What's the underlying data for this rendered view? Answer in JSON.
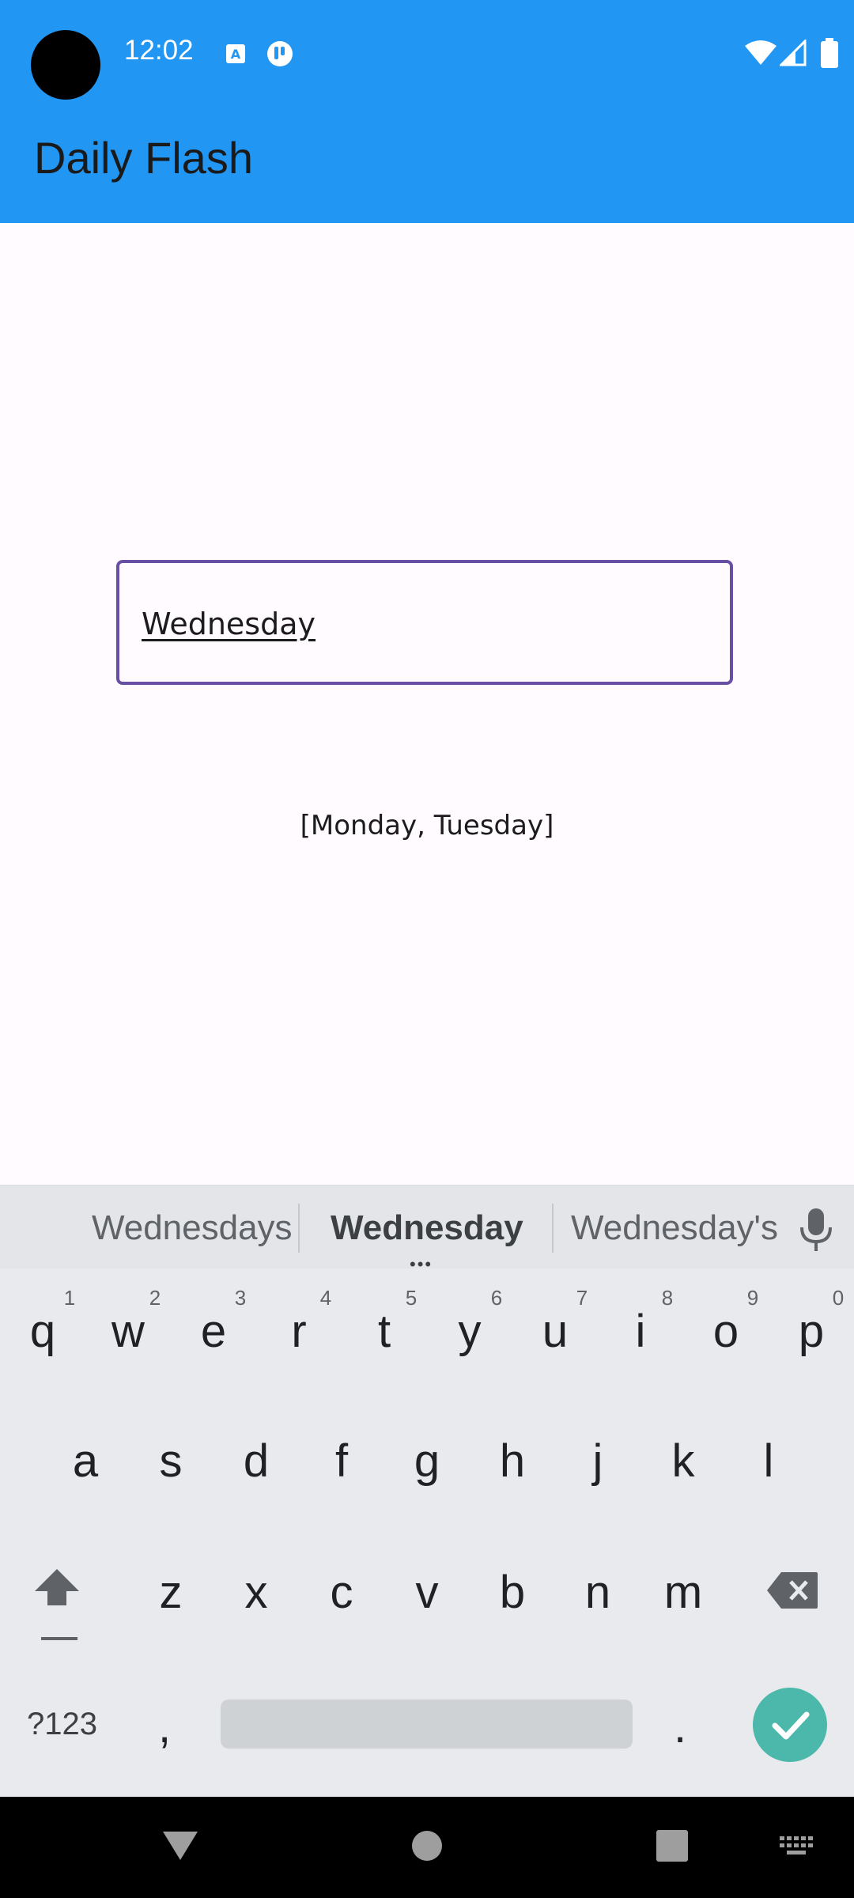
{
  "status_bar": {
    "time": "12:02"
  },
  "app_bar": {
    "title": "Daily Flash"
  },
  "input": {
    "value": "Wednesday"
  },
  "days_list": {
    "text": "[Monday, Tuesday]"
  },
  "keyboard": {
    "suggestions": [
      "Wednesdays",
      "Wednesday",
      "Wednesday's"
    ],
    "row1": [
      "q",
      "w",
      "e",
      "r",
      "t",
      "y",
      "u",
      "i",
      "o",
      "p"
    ],
    "row1_hints": [
      "1",
      "2",
      "3",
      "4",
      "5",
      "6",
      "7",
      "8",
      "9",
      "0"
    ],
    "row2": [
      "a",
      "s",
      "d",
      "f",
      "g",
      "h",
      "j",
      "k",
      "l"
    ],
    "row3": [
      "z",
      "x",
      "c",
      "v",
      "b",
      "n",
      "m"
    ],
    "symbols_label": "?123",
    "comma": ",",
    "period": "."
  },
  "colors": {
    "app_bar": "#2196f3",
    "field_border": "#6750a4",
    "enter_key": "#4cb8ab"
  }
}
